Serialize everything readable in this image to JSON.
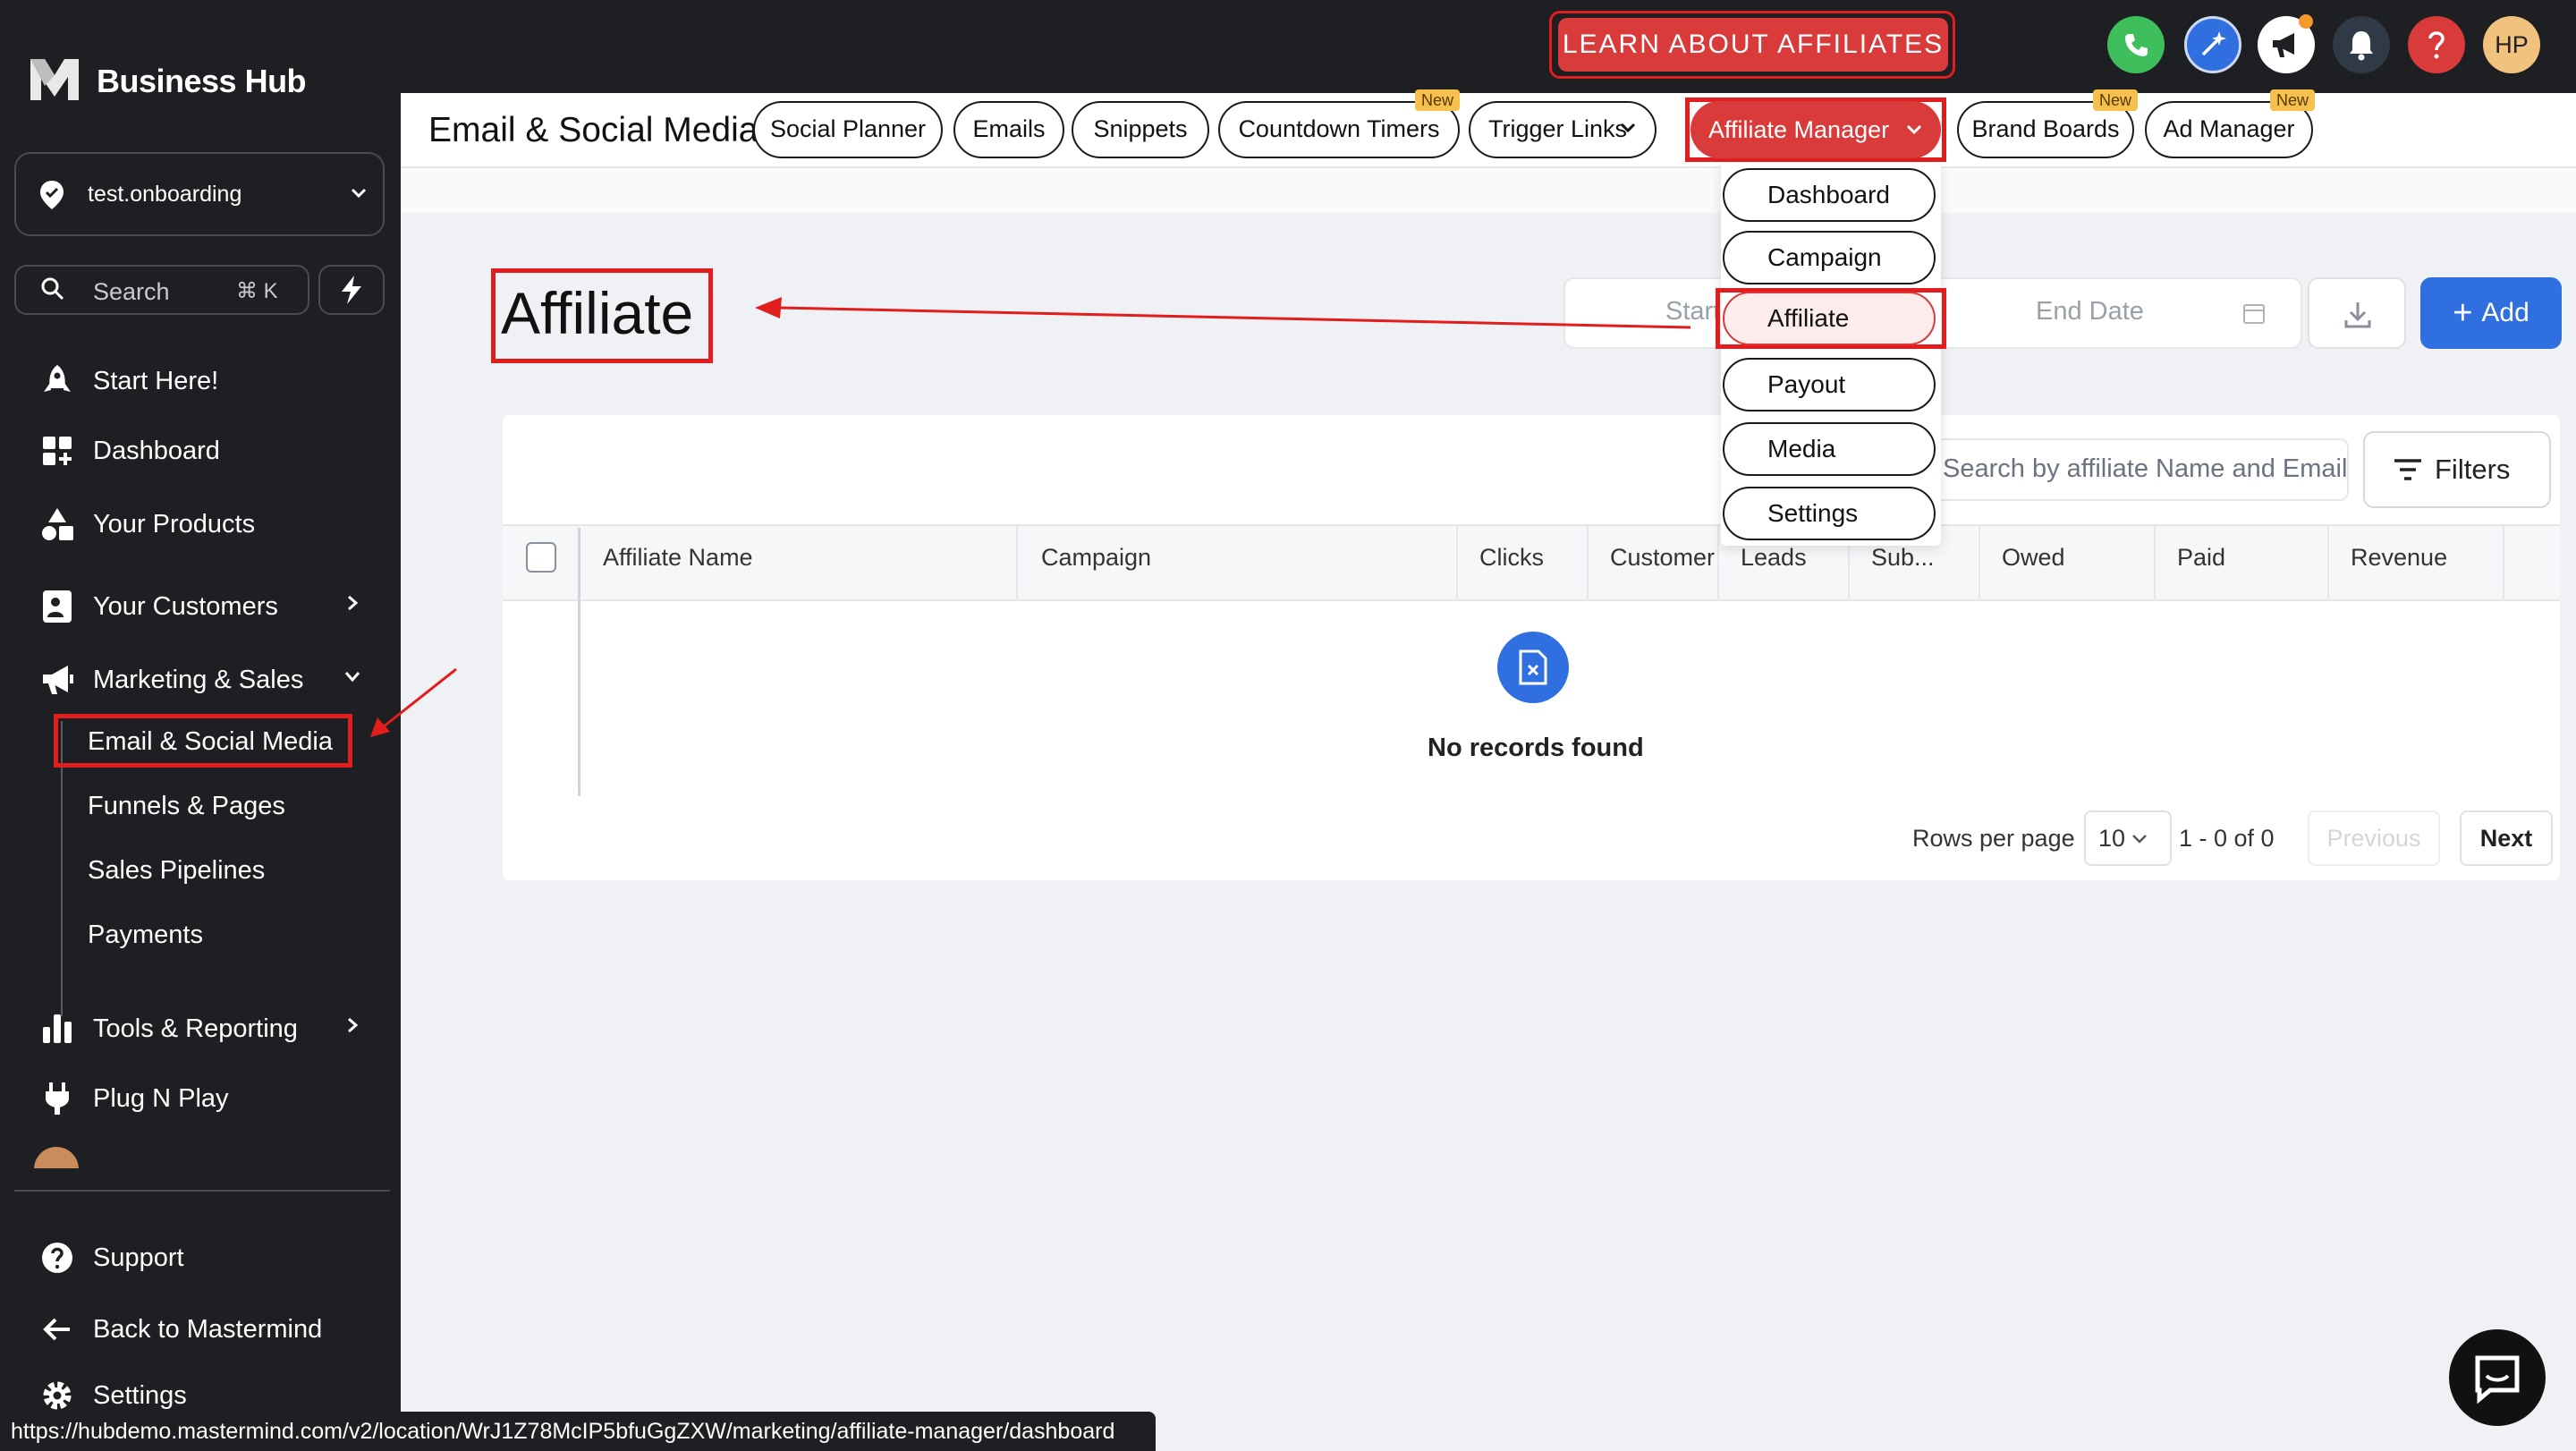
{
  "brand": {
    "name": "Business Hub"
  },
  "sidebar": {
    "location": "test.onboarding",
    "search_placeholder": "Search",
    "search_shortcut": "⌘ K",
    "items": [
      {
        "label": "Start Here!",
        "icon": "rocket-icon"
      },
      {
        "label": "Dashboard",
        "icon": "dashboard-icon"
      },
      {
        "label": "Your Products",
        "icon": "products-icon"
      },
      {
        "label": "Your Customers",
        "icon": "customers-icon"
      },
      {
        "label": "Marketing & Sales",
        "icon": "megaphone-icon"
      },
      {
        "label": "Tools & Reporting",
        "icon": "bar-chart-icon"
      },
      {
        "label": "Plug N Play",
        "icon": "plug-icon"
      }
    ],
    "sub_items": [
      "Email & Social Media",
      "Funnels & Pages",
      "Sales Pipelines",
      "Payments"
    ],
    "footer": [
      {
        "label": "Support",
        "icon": "help-circle-icon"
      },
      {
        "label": "Back to Mastermind",
        "icon": "arrow-left-icon"
      },
      {
        "label": "Settings",
        "icon": "gear-icon"
      }
    ]
  },
  "topbar": {
    "learn_button": "LEARN ABOUT AFFILIATES",
    "avatar_initials": "HP",
    "colors": {
      "phone": "#3fbf5c",
      "magic": "#2f6fe0",
      "help": "#d93a3a",
      "avatar": "#f1c27d"
    }
  },
  "subnav": {
    "title": "Email & Social Media",
    "tabs": [
      "Social Planner",
      "Emails",
      "Snippets",
      "Countdown Timers",
      "Trigger Links",
      "Affiliate Manager",
      "Brand Boards",
      "Ad Manager"
    ],
    "new_badge": "New"
  },
  "dropdown": {
    "items": [
      "Dashboard",
      "Campaign",
      "Affiliate",
      "Payout",
      "Media",
      "Settings"
    ]
  },
  "main": {
    "heading": "Affiliate",
    "start_date_placeholder": "Start Date",
    "end_date_placeholder": "End Date",
    "add_label": "Add",
    "search_placeholder": "Search by affiliate Name and Email",
    "filters_label": "Filters",
    "columns": [
      "Affiliate Name",
      "Campaign",
      "Clicks",
      "Customer",
      "Leads",
      "Sub...",
      "Owed",
      "Paid",
      "Revenue"
    ],
    "empty_text": "No records found",
    "rows_per_page_label": "Rows per page",
    "rows_per_page_value": "10",
    "range_text": "1 - 0 of 0",
    "previous_label": "Previous",
    "next_label": "Next"
  },
  "status_url": "https://hubdemo.mastermind.com/v2/location/WrJ1Z78McIP5bfuGgZXW/marketing/affiliate-manager/dashboard",
  "accent_colors": {
    "primary": "#2f6fe0",
    "highlight": "#e11d1d",
    "sidebar": "#1e1f22"
  }
}
